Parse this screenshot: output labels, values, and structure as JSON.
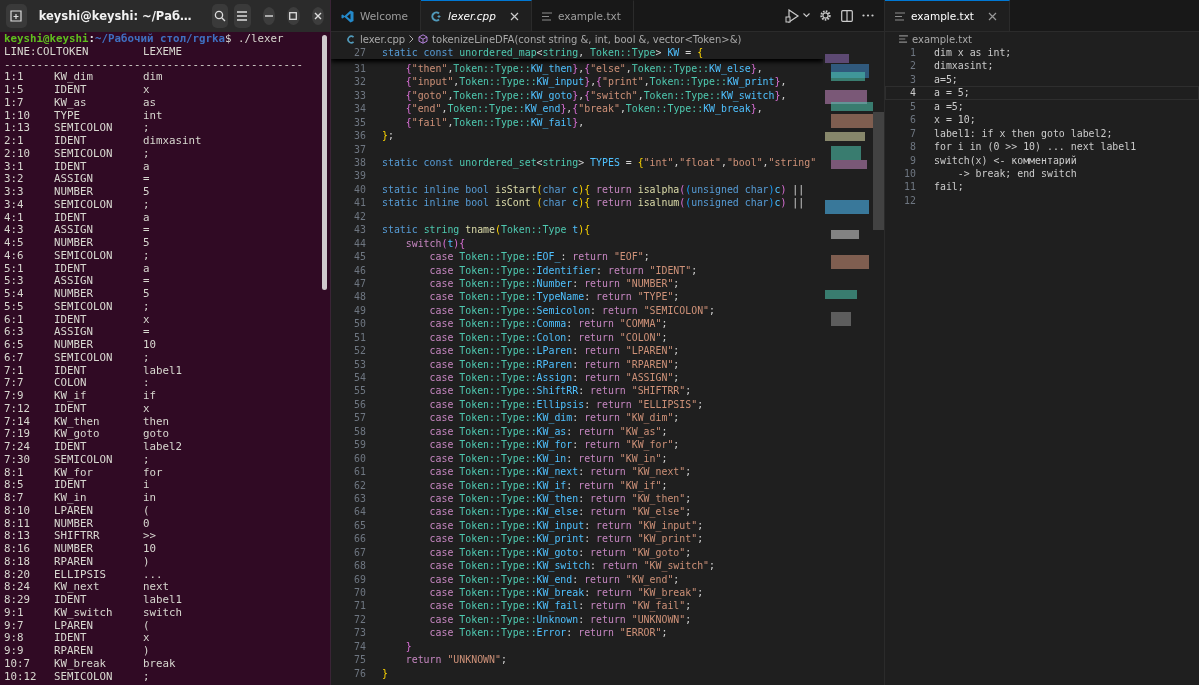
{
  "terminal": {
    "title": "keyshi@keyshi: ~/Раб…",
    "prompt": {
      "user": "keyshi@keyshi",
      "separator": ":",
      "path": "~/Рабочий стол/rgrka",
      "command": "$ ./lexer"
    },
    "header": [
      "LINE:COLTOKEN",
      "LEXEME"
    ],
    "rule": "----------------------------------------------",
    "rows": [
      [
        "1:1",
        "KW_dim",
        "dim"
      ],
      [
        "1:5",
        "IDENT",
        "x"
      ],
      [
        "1:7",
        "KW_as",
        "as"
      ],
      [
        "1:10",
        "TYPE",
        "int"
      ],
      [
        "1:13",
        "SEMICOLON",
        ";"
      ],
      [
        "2:1",
        "IDENT",
        "dimxasint"
      ],
      [
        "2:10",
        "SEMICOLON",
        ";"
      ],
      [
        "3:1",
        "IDENT",
        "a"
      ],
      [
        "3:2",
        "ASSIGN",
        "="
      ],
      [
        "3:3",
        "NUMBER",
        "5"
      ],
      [
        "3:4",
        "SEMICOLON",
        ";"
      ],
      [
        "4:1",
        "IDENT",
        "a"
      ],
      [
        "4:3",
        "ASSIGN",
        "="
      ],
      [
        "4:5",
        "NUMBER",
        "5"
      ],
      [
        "4:6",
        "SEMICOLON",
        ";"
      ],
      [
        "5:1",
        "IDENT",
        "a"
      ],
      [
        "5:3",
        "ASSIGN",
        "="
      ],
      [
        "5:4",
        "NUMBER",
        "5"
      ],
      [
        "5:5",
        "SEMICOLON",
        ";"
      ],
      [
        "6:1",
        "IDENT",
        "x"
      ],
      [
        "6:3",
        "ASSIGN",
        "="
      ],
      [
        "6:5",
        "NUMBER",
        "10"
      ],
      [
        "6:7",
        "SEMICOLON",
        ";"
      ],
      [
        "7:1",
        "IDENT",
        "label1"
      ],
      [
        "7:7",
        "COLON",
        ":"
      ],
      [
        "7:9",
        "KW_if",
        "if"
      ],
      [
        "7:12",
        "IDENT",
        "x"
      ],
      [
        "7:14",
        "KW_then",
        "then"
      ],
      [
        "7:19",
        "KW_goto",
        "goto"
      ],
      [
        "7:24",
        "IDENT",
        "label2"
      ],
      [
        "7:30",
        "SEMICOLON",
        ";"
      ],
      [
        "8:1",
        "KW_for",
        "for"
      ],
      [
        "8:5",
        "IDENT",
        "i"
      ],
      [
        "8:7",
        "KW_in",
        "in"
      ],
      [
        "8:10",
        "LPAREN",
        "("
      ],
      [
        "8:11",
        "NUMBER",
        "0"
      ],
      [
        "8:13",
        "SHIFTRR",
        ">>"
      ],
      [
        "8:16",
        "NUMBER",
        "10"
      ],
      [
        "8:18",
        "RPAREN",
        ")"
      ],
      [
        "8:20",
        "ELLIPSIS",
        "..."
      ],
      [
        "8:24",
        "KW_next",
        "next"
      ],
      [
        "8:29",
        "IDENT",
        "label1"
      ],
      [
        "9:1",
        "KW_switch",
        "switch"
      ],
      [
        "9:7",
        "LPAREN",
        "("
      ],
      [
        "9:8",
        "IDENT",
        "x"
      ],
      [
        "9:9",
        "RPAREN",
        ")"
      ],
      [
        "10:7",
        "KW_break",
        "break"
      ],
      [
        "10:12",
        "SEMICOLON",
        ";"
      ]
    ]
  },
  "editor": {
    "tabs": [
      {
        "label": "Welcome",
        "kind": "welcome",
        "selected": false,
        "preview": false
      },
      {
        "label": "lexer.cpp",
        "kind": "cpp",
        "selected": true,
        "preview": true
      },
      {
        "label": "example.txt",
        "kind": "text",
        "selected": false,
        "preview": false
      }
    ],
    "breadcrumb": {
      "file": "lexer.cpp",
      "symbol": "tokenizeLineDFA(const string &, int, bool &, vector<Token>&)"
    },
    "sticky": {
      "number": "27",
      "tokens": [
        {
          "text": "static const ",
          "kind": "kw"
        },
        {
          "text": "unordered_map",
          "kind": "type"
        },
        {
          "text": "<",
          "kind": "pun"
        },
        {
          "text": "string",
          "kind": "type"
        },
        {
          "text": ", ",
          "kind": "pun"
        },
        {
          "text": "Token::Type",
          "kind": "type"
        },
        {
          "text": "> ",
          "kind": "pun"
        },
        {
          "text": "KW",
          "kind": "mem"
        },
        {
          "text": " = ",
          "kind": "pun"
        },
        {
          "text": "{",
          "kind": "br1"
        }
      ]
    },
    "lines": [
      {
        "number": "31",
        "tokens": [
          {
            "text": "    {",
            "kind": "br2"
          },
          {
            "text": "\"then\"",
            "kind": "str"
          },
          {
            "text": ",",
            "kind": "pun"
          },
          {
            "text": "Token::Type::",
            "kind": "type"
          },
          {
            "text": "KW_then",
            "kind": "mem"
          },
          {
            "text": "}",
            "kind": "br2"
          },
          {
            "text": ",",
            "kind": "pun"
          },
          {
            "text": "{",
            "kind": "br2"
          },
          {
            "text": "\"else\"",
            "kind": "str"
          },
          {
            "text": ",",
            "kind": "pun"
          },
          {
            "text": "Token::Type::",
            "kind": "type"
          },
          {
            "text": "KW_else",
            "kind": "mem"
          },
          {
            "text": "}",
            "kind": "br2"
          },
          {
            "text": ",",
            "kind": "pun"
          }
        ]
      },
      {
        "number": "32",
        "tokens": [
          {
            "text": "    {",
            "kind": "br2"
          },
          {
            "text": "\"input\"",
            "kind": "str"
          },
          {
            "text": ",",
            "kind": "pun"
          },
          {
            "text": "Token::Type::",
            "kind": "type"
          },
          {
            "text": "KW_input",
            "kind": "mem"
          },
          {
            "text": "}",
            "kind": "br2"
          },
          {
            "text": ",",
            "kind": "pun"
          },
          {
            "text": "{",
            "kind": "br2"
          },
          {
            "text": "\"print\"",
            "kind": "str"
          },
          {
            "text": ",",
            "kind": "pun"
          },
          {
            "text": "Token::Type::",
            "kind": "type"
          },
          {
            "text": "KW_print",
            "kind": "mem"
          },
          {
            "text": "}",
            "kind": "br2"
          },
          {
            "text": ",",
            "kind": "pun"
          }
        ]
      },
      {
        "number": "33",
        "tokens": [
          {
            "text": "    {",
            "kind": "br2"
          },
          {
            "text": "\"goto\"",
            "kind": "str"
          },
          {
            "text": ",",
            "kind": "pun"
          },
          {
            "text": "Token::Type::",
            "kind": "type"
          },
          {
            "text": "KW_goto",
            "kind": "mem"
          },
          {
            "text": "}",
            "kind": "br2"
          },
          {
            "text": ",",
            "kind": "pun"
          },
          {
            "text": "{",
            "kind": "br2"
          },
          {
            "text": "\"switch\"",
            "kind": "str"
          },
          {
            "text": ",",
            "kind": "pun"
          },
          {
            "text": "Token::Type::",
            "kind": "type"
          },
          {
            "text": "KW_switch",
            "kind": "mem"
          },
          {
            "text": "}",
            "kind": "br2"
          },
          {
            "text": ",",
            "kind": "pun"
          }
        ]
      },
      {
        "number": "34",
        "tokens": [
          {
            "text": "    {",
            "kind": "br2"
          },
          {
            "text": "\"end\"",
            "kind": "str"
          },
          {
            "text": ",",
            "kind": "pun"
          },
          {
            "text": "Token::Type::",
            "kind": "type"
          },
          {
            "text": "KW_end",
            "kind": "mem"
          },
          {
            "text": "}",
            "kind": "br2"
          },
          {
            "text": ",",
            "kind": "pun"
          },
          {
            "text": "{",
            "kind": "br2"
          },
          {
            "text": "\"break\"",
            "kind": "str"
          },
          {
            "text": ",",
            "kind": "pun"
          },
          {
            "text": "Token::Type::",
            "kind": "type"
          },
          {
            "text": "KW_break",
            "kind": "mem"
          },
          {
            "text": "}",
            "kind": "br2"
          },
          {
            "text": ",",
            "kind": "pun"
          }
        ]
      },
      {
        "number": "35",
        "tokens": [
          {
            "text": "    {",
            "kind": "br2"
          },
          {
            "text": "\"fail\"",
            "kind": "str"
          },
          {
            "text": ",",
            "kind": "pun"
          },
          {
            "text": "Token::Type::",
            "kind": "type"
          },
          {
            "text": "KW_fail",
            "kind": "mem"
          },
          {
            "text": "}",
            "kind": "br2"
          },
          {
            "text": ",",
            "kind": "pun"
          }
        ]
      },
      {
        "number": "36",
        "tokens": [
          {
            "text": "}",
            "kind": "br1"
          },
          {
            "text": ";",
            "kind": "pun"
          }
        ]
      },
      {
        "number": "37"
      },
      {
        "number": "38",
        "tokens": [
          {
            "text": "static const ",
            "kind": "kw"
          },
          {
            "text": "unordered_set",
            "kind": "type"
          },
          {
            "text": "<",
            "kind": "pun"
          },
          {
            "text": "string",
            "kind": "type"
          },
          {
            "text": "> ",
            "kind": "pun"
          },
          {
            "text": "TYPES",
            "kind": "mem"
          },
          {
            "text": " = ",
            "kind": "pun"
          },
          {
            "text": "{",
            "kind": "br1"
          },
          {
            "text": "\"int\"",
            "kind": "str"
          },
          {
            "text": ",",
            "kind": "pun"
          },
          {
            "text": "\"float\"",
            "kind": "str"
          },
          {
            "text": ",",
            "kind": "pun"
          },
          {
            "text": "\"bool\"",
            "kind": "str"
          },
          {
            "text": ",",
            "kind": "pun"
          },
          {
            "text": "\"string\"",
            "kind": "str"
          }
        ]
      },
      {
        "number": "39"
      },
      {
        "number": "40",
        "tokens": [
          {
            "text": "static inline bool ",
            "kind": "kw"
          },
          {
            "text": "isStart",
            "kind": "fn"
          },
          {
            "text": "(",
            "kind": "br1"
          },
          {
            "text": "char ",
            "kind": "kw"
          },
          {
            "text": "c",
            "kind": "mem"
          },
          {
            "text": ")",
            "kind": "br1"
          },
          {
            "text": "{",
            "kind": "br1"
          },
          {
            "text": " return ",
            "kind": "ctl"
          },
          {
            "text": "isalpha",
            "kind": "fn"
          },
          {
            "text": "(",
            "kind": "br2"
          },
          {
            "text": "(",
            "kind": "br3"
          },
          {
            "text": "unsigned char",
            "kind": "kw"
          },
          {
            "text": ")",
            "kind": "br3"
          },
          {
            "text": "c",
            "kind": "mem"
          },
          {
            "text": ")",
            "kind": "br2"
          },
          {
            "text": " ||",
            "kind": "pun"
          }
        ]
      },
      {
        "number": "41",
        "tokens": [
          {
            "text": "static inline bool ",
            "kind": "kw"
          },
          {
            "text": "isCont ",
            "kind": "fn"
          },
          {
            "text": "(",
            "kind": "br1"
          },
          {
            "text": "char ",
            "kind": "kw"
          },
          {
            "text": "c",
            "kind": "mem"
          },
          {
            "text": ")",
            "kind": "br1"
          },
          {
            "text": "{",
            "kind": "br1"
          },
          {
            "text": " return ",
            "kind": "ctl"
          },
          {
            "text": "isalnum",
            "kind": "fn"
          },
          {
            "text": "(",
            "kind": "br2"
          },
          {
            "text": "(",
            "kind": "br3"
          },
          {
            "text": "unsigned char",
            "kind": "kw"
          },
          {
            "text": ")",
            "kind": "br3"
          },
          {
            "text": "c",
            "kind": "mem"
          },
          {
            "text": ")",
            "kind": "br2"
          },
          {
            "text": " ||",
            "kind": "pun"
          }
        ]
      },
      {
        "number": "42"
      },
      {
        "number": "43",
        "tokens": [
          {
            "text": "static ",
            "kind": "kw"
          },
          {
            "text": "string ",
            "kind": "type"
          },
          {
            "text": "tname",
            "kind": "fn"
          },
          {
            "text": "(",
            "kind": "br1"
          },
          {
            "text": "Token::Type ",
            "kind": "type"
          },
          {
            "text": "t",
            "kind": "mem"
          },
          {
            "text": ")",
            "kind": "br1"
          },
          {
            "text": "{",
            "kind": "br1"
          }
        ]
      },
      {
        "number": "44",
        "tokens": [
          {
            "text": "    switch",
            "kind": "ctl"
          },
          {
            "text": "(",
            "kind": "br2"
          },
          {
            "text": "t",
            "kind": "mem"
          },
          {
            "text": ")",
            "kind": "br2"
          },
          {
            "text": "{",
            "kind": "br2"
          }
        ]
      },
      {
        "number": "45",
        "tokens": [
          {
            "text": "        case ",
            "kind": "ctl"
          },
          {
            "text": "Token::Type::",
            "kind": "type"
          },
          {
            "text": "EOF_",
            "kind": "mem"
          },
          {
            "text": ": ",
            "kind": "pun"
          },
          {
            "text": "return ",
            "kind": "ctl"
          },
          {
            "text": "\"EOF\"",
            "kind": "str"
          },
          {
            "text": ";",
            "kind": "pun"
          }
        ]
      },
      {
        "number": "46",
        "tokens": [
          {
            "text": "        case ",
            "kind": "ctl"
          },
          {
            "text": "Token::Type::",
            "kind": "type"
          },
          {
            "text": "Identifier",
            "kind": "mem"
          },
          {
            "text": ": ",
            "kind": "pun"
          },
          {
            "text": "return ",
            "kind": "ctl"
          },
          {
            "text": "\"IDENT\"",
            "kind": "str"
          },
          {
            "text": ";",
            "kind": "pun"
          }
        ]
      },
      {
        "number": "47",
        "tokens": [
          {
            "text": "        case ",
            "kind": "ctl"
          },
          {
            "text": "Token::Type::",
            "kind": "type"
          },
          {
            "text": "Number",
            "kind": "mem"
          },
          {
            "text": ": ",
            "kind": "pun"
          },
          {
            "text": "return ",
            "kind": "ctl"
          },
          {
            "text": "\"NUMBER\"",
            "kind": "str"
          },
          {
            "text": ";",
            "kind": "pun"
          }
        ]
      },
      {
        "number": "48",
        "tokens": [
          {
            "text": "        case ",
            "kind": "ctl"
          },
          {
            "text": "Token::Type::",
            "kind": "type"
          },
          {
            "text": "TypeName",
            "kind": "mem"
          },
          {
            "text": ": ",
            "kind": "pun"
          },
          {
            "text": "return ",
            "kind": "ctl"
          },
          {
            "text": "\"TYPE\"",
            "kind": "str"
          },
          {
            "text": ";",
            "kind": "pun"
          }
        ]
      },
      {
        "number": "49",
        "tokens": [
          {
            "text": "        case ",
            "kind": "ctl"
          },
          {
            "text": "Token::Type::",
            "kind": "type"
          },
          {
            "text": "Semicolon",
            "kind": "mem"
          },
          {
            "text": ": ",
            "kind": "pun"
          },
          {
            "text": "return ",
            "kind": "ctl"
          },
          {
            "text": "\"SEMICOLON\"",
            "kind": "str"
          },
          {
            "text": ";",
            "kind": "pun"
          }
        ]
      },
      {
        "number": "50",
        "tokens": [
          {
            "text": "        case ",
            "kind": "ctl"
          },
          {
            "text": "Token::Type::",
            "kind": "type"
          },
          {
            "text": "Comma",
            "kind": "mem"
          },
          {
            "text": ": ",
            "kind": "pun"
          },
          {
            "text": "return ",
            "kind": "ctl"
          },
          {
            "text": "\"COMMA\"",
            "kind": "str"
          },
          {
            "text": ";",
            "kind": "pun"
          }
        ]
      },
      {
        "number": "51",
        "tokens": [
          {
            "text": "        case ",
            "kind": "ctl"
          },
          {
            "text": "Token::Type::",
            "kind": "type"
          },
          {
            "text": "Colon",
            "kind": "mem"
          },
          {
            "text": ": ",
            "kind": "pun"
          },
          {
            "text": "return ",
            "kind": "ctl"
          },
          {
            "text": "\"COLON\"",
            "kind": "str"
          },
          {
            "text": ";",
            "kind": "pun"
          }
        ]
      },
      {
        "number": "52",
        "tokens": [
          {
            "text": "        case ",
            "kind": "ctl"
          },
          {
            "text": "Token::Type::",
            "kind": "type"
          },
          {
            "text": "LParen",
            "kind": "mem"
          },
          {
            "text": ": ",
            "kind": "pun"
          },
          {
            "text": "return ",
            "kind": "ctl"
          },
          {
            "text": "\"LPAREN\"",
            "kind": "str"
          },
          {
            "text": ";",
            "kind": "pun"
          }
        ]
      },
      {
        "number": "53",
        "tokens": [
          {
            "text": "        case ",
            "kind": "ctl"
          },
          {
            "text": "Token::Type::",
            "kind": "type"
          },
          {
            "text": "RParen",
            "kind": "mem"
          },
          {
            "text": ": ",
            "kind": "pun"
          },
          {
            "text": "return ",
            "kind": "ctl"
          },
          {
            "text": "\"RPAREN\"",
            "kind": "str"
          },
          {
            "text": ";",
            "kind": "pun"
          }
        ]
      },
      {
        "number": "54",
        "tokens": [
          {
            "text": "        case ",
            "kind": "ctl"
          },
          {
            "text": "Token::Type::",
            "kind": "type"
          },
          {
            "text": "Assign",
            "kind": "mem"
          },
          {
            "text": ": ",
            "kind": "pun"
          },
          {
            "text": "return ",
            "kind": "ctl"
          },
          {
            "text": "\"ASSIGN\"",
            "kind": "str"
          },
          {
            "text": ";",
            "kind": "pun"
          }
        ]
      },
      {
        "number": "55",
        "tokens": [
          {
            "text": "        case ",
            "kind": "ctl"
          },
          {
            "text": "Token::Type::",
            "kind": "type"
          },
          {
            "text": "ShiftRR",
            "kind": "mem"
          },
          {
            "text": ": ",
            "kind": "pun"
          },
          {
            "text": "return ",
            "kind": "ctl"
          },
          {
            "text": "\"SHIFTRR\"",
            "kind": "str"
          },
          {
            "text": ";",
            "kind": "pun"
          }
        ]
      },
      {
        "number": "56",
        "tokens": [
          {
            "text": "        case ",
            "kind": "ctl"
          },
          {
            "text": "Token::Type::",
            "kind": "type"
          },
          {
            "text": "Ellipsis",
            "kind": "mem"
          },
          {
            "text": ": ",
            "kind": "pun"
          },
          {
            "text": "return ",
            "kind": "ctl"
          },
          {
            "text": "\"ELLIPSIS\"",
            "kind": "str"
          },
          {
            "text": ";",
            "kind": "pun"
          }
        ]
      },
      {
        "number": "57",
        "tokens": [
          {
            "text": "        case ",
            "kind": "ctl"
          },
          {
            "text": "Token::Type::",
            "kind": "type"
          },
          {
            "text": "KW_dim",
            "kind": "mem"
          },
          {
            "text": ": ",
            "kind": "pun"
          },
          {
            "text": "return ",
            "kind": "ctl"
          },
          {
            "text": "\"KW_dim\"",
            "kind": "str"
          },
          {
            "text": ";",
            "kind": "pun"
          }
        ]
      },
      {
        "number": "58",
        "tokens": [
          {
            "text": "        case ",
            "kind": "ctl"
          },
          {
            "text": "Token::Type::",
            "kind": "type"
          },
          {
            "text": "KW_as",
            "kind": "mem"
          },
          {
            "text": ": ",
            "kind": "pun"
          },
          {
            "text": "return ",
            "kind": "ctl"
          },
          {
            "text": "\"KW_as\"",
            "kind": "str"
          },
          {
            "text": ";",
            "kind": "pun"
          }
        ]
      },
      {
        "number": "59",
        "tokens": [
          {
            "text": "        case ",
            "kind": "ctl"
          },
          {
            "text": "Token::Type::",
            "kind": "type"
          },
          {
            "text": "KW_for",
            "kind": "mem"
          },
          {
            "text": ": ",
            "kind": "pun"
          },
          {
            "text": "return ",
            "kind": "ctl"
          },
          {
            "text": "\"KW_for\"",
            "kind": "str"
          },
          {
            "text": ";",
            "kind": "pun"
          }
        ]
      },
      {
        "number": "60",
        "tokens": [
          {
            "text": "        case ",
            "kind": "ctl"
          },
          {
            "text": "Token::Type::",
            "kind": "type"
          },
          {
            "text": "KW_in",
            "kind": "mem"
          },
          {
            "text": ": ",
            "kind": "pun"
          },
          {
            "text": "return ",
            "kind": "ctl"
          },
          {
            "text": "\"KW_in\"",
            "kind": "str"
          },
          {
            "text": ";",
            "kind": "pun"
          }
        ]
      },
      {
        "number": "61",
        "tokens": [
          {
            "text": "        case ",
            "kind": "ctl"
          },
          {
            "text": "Token::Type::",
            "kind": "type"
          },
          {
            "text": "KW_next",
            "kind": "mem"
          },
          {
            "text": ": ",
            "kind": "pun"
          },
          {
            "text": "return ",
            "kind": "ctl"
          },
          {
            "text": "\"KW_next\"",
            "kind": "str"
          },
          {
            "text": ";",
            "kind": "pun"
          }
        ]
      },
      {
        "number": "62",
        "tokens": [
          {
            "text": "        case ",
            "kind": "ctl"
          },
          {
            "text": "Token::Type::",
            "kind": "type"
          },
          {
            "text": "KW_if",
            "kind": "mem"
          },
          {
            "text": ": ",
            "kind": "pun"
          },
          {
            "text": "return ",
            "kind": "ctl"
          },
          {
            "text": "\"KW_if\"",
            "kind": "str"
          },
          {
            "text": ";",
            "kind": "pun"
          }
        ]
      },
      {
        "number": "63",
        "tokens": [
          {
            "text": "        case ",
            "kind": "ctl"
          },
          {
            "text": "Token::Type::",
            "kind": "type"
          },
          {
            "text": "KW_then",
            "kind": "mem"
          },
          {
            "text": ": ",
            "kind": "pun"
          },
          {
            "text": "return ",
            "kind": "ctl"
          },
          {
            "text": "\"KW_then\"",
            "kind": "str"
          },
          {
            "text": ";",
            "kind": "pun"
          }
        ]
      },
      {
        "number": "64",
        "tokens": [
          {
            "text": "        case ",
            "kind": "ctl"
          },
          {
            "text": "Token::Type::",
            "kind": "type"
          },
          {
            "text": "KW_else",
            "kind": "mem"
          },
          {
            "text": ": ",
            "kind": "pun"
          },
          {
            "text": "return ",
            "kind": "ctl"
          },
          {
            "text": "\"KW_else\"",
            "kind": "str"
          },
          {
            "text": ";",
            "kind": "pun"
          }
        ]
      },
      {
        "number": "65",
        "tokens": [
          {
            "text": "        case ",
            "kind": "ctl"
          },
          {
            "text": "Token::Type::",
            "kind": "type"
          },
          {
            "text": "KW_input",
            "kind": "mem"
          },
          {
            "text": ": ",
            "kind": "pun"
          },
          {
            "text": "return ",
            "kind": "ctl"
          },
          {
            "text": "\"KW_input\"",
            "kind": "str"
          },
          {
            "text": ";",
            "kind": "pun"
          }
        ]
      },
      {
        "number": "66",
        "tokens": [
          {
            "text": "        case ",
            "kind": "ctl"
          },
          {
            "text": "Token::Type::",
            "kind": "type"
          },
          {
            "text": "KW_print",
            "kind": "mem"
          },
          {
            "text": ": ",
            "kind": "pun"
          },
          {
            "text": "return ",
            "kind": "ctl"
          },
          {
            "text": "\"KW_print\"",
            "kind": "str"
          },
          {
            "text": ";",
            "kind": "pun"
          }
        ]
      },
      {
        "number": "67",
        "tokens": [
          {
            "text": "        case ",
            "kind": "ctl"
          },
          {
            "text": "Token::Type::",
            "kind": "type"
          },
          {
            "text": "KW_goto",
            "kind": "mem"
          },
          {
            "text": ": ",
            "kind": "pun"
          },
          {
            "text": "return ",
            "kind": "ctl"
          },
          {
            "text": "\"KW_goto\"",
            "kind": "str"
          },
          {
            "text": ";",
            "kind": "pun"
          }
        ]
      },
      {
        "number": "68",
        "tokens": [
          {
            "text": "        case ",
            "kind": "ctl"
          },
          {
            "text": "Token::Type::",
            "kind": "type"
          },
          {
            "text": "KW_switch",
            "kind": "mem"
          },
          {
            "text": ": ",
            "kind": "pun"
          },
          {
            "text": "return ",
            "kind": "ctl"
          },
          {
            "text": "\"KW_switch\"",
            "kind": "str"
          },
          {
            "text": ";",
            "kind": "pun"
          }
        ]
      },
      {
        "number": "69",
        "tokens": [
          {
            "text": "        case ",
            "kind": "ctl"
          },
          {
            "text": "Token::Type::",
            "kind": "type"
          },
          {
            "text": "KW_end",
            "kind": "mem"
          },
          {
            "text": ": ",
            "kind": "pun"
          },
          {
            "text": "return ",
            "kind": "ctl"
          },
          {
            "text": "\"KW_end\"",
            "kind": "str"
          },
          {
            "text": ";",
            "kind": "pun"
          }
        ]
      },
      {
        "number": "70",
        "tokens": [
          {
            "text": "        case ",
            "kind": "ctl"
          },
          {
            "text": "Token::Type::",
            "kind": "type"
          },
          {
            "text": "KW_break",
            "kind": "mem"
          },
          {
            "text": ": ",
            "kind": "pun"
          },
          {
            "text": "return ",
            "kind": "ctl"
          },
          {
            "text": "\"KW_break\"",
            "kind": "str"
          },
          {
            "text": ";",
            "kind": "pun"
          }
        ]
      },
      {
        "number": "71",
        "tokens": [
          {
            "text": "        case ",
            "kind": "ctl"
          },
          {
            "text": "Token::Type::",
            "kind": "type"
          },
          {
            "text": "KW_fail",
            "kind": "mem"
          },
          {
            "text": ": ",
            "kind": "pun"
          },
          {
            "text": "return ",
            "kind": "ctl"
          },
          {
            "text": "\"KW_fail\"",
            "kind": "str"
          },
          {
            "text": ";",
            "kind": "pun"
          }
        ]
      },
      {
        "number": "72",
        "tokens": [
          {
            "text": "        case ",
            "kind": "ctl"
          },
          {
            "text": "Token::Type::",
            "kind": "type"
          },
          {
            "text": "Unknown",
            "kind": "mem"
          },
          {
            "text": ": ",
            "kind": "pun"
          },
          {
            "text": "return ",
            "kind": "ctl"
          },
          {
            "text": "\"UNKNOWN\"",
            "kind": "str"
          },
          {
            "text": ";",
            "kind": "pun"
          }
        ]
      },
      {
        "number": "73",
        "tokens": [
          {
            "text": "        case ",
            "kind": "ctl"
          },
          {
            "text": "Token::Type::",
            "kind": "type"
          },
          {
            "text": "Error",
            "kind": "mem"
          },
          {
            "text": ": ",
            "kind": "pun"
          },
          {
            "text": "return ",
            "kind": "ctl"
          },
          {
            "text": "\"ERROR\"",
            "kind": "str"
          },
          {
            "text": ";",
            "kind": "pun"
          }
        ]
      },
      {
        "number": "74",
        "tokens": [
          {
            "text": "    }",
            "kind": "br2"
          }
        ]
      },
      {
        "number": "75",
        "tokens": [
          {
            "text": "    return ",
            "kind": "ctl"
          },
          {
            "text": "\"UNKNOWN\"",
            "kind": "str"
          },
          {
            "text": ";",
            "kind": "pun"
          }
        ]
      },
      {
        "number": "76",
        "tokens": [
          {
            "text": "}",
            "kind": "br1"
          }
        ]
      }
    ]
  },
  "side_editor": {
    "tabs": [
      {
        "label": "example.txt",
        "kind": "text",
        "selected": true,
        "preview": false
      }
    ],
    "breadcrumb": "example.txt",
    "lines": [
      {
        "number": "1",
        "text": "dim x as int;",
        "current": false
      },
      {
        "number": "2",
        "text": "dimxasint;",
        "current": false
      },
      {
        "number": "3",
        "text": "a=5;",
        "current": false
      },
      {
        "number": "4",
        "text": "a = 5;",
        "current": true
      },
      {
        "number": "5",
        "text": "a =5;",
        "current": false
      },
      {
        "number": "6",
        "text": "x = 10;",
        "current": false
      },
      {
        "number": "7",
        "text": "label1: if x then goto label2;",
        "current": false
      },
      {
        "number": "8",
        "text": "for i in (0 >> 10) ... next label1",
        "current": false
      },
      {
        "number": "9",
        "text": "switch(x) <- комментарий",
        "current": false
      },
      {
        "number": "10",
        "text": "    -> break; end switch",
        "current": false
      },
      {
        "number": "11",
        "text": "fail;",
        "current": false
      },
      {
        "number": "12",
        "current": false
      }
    ]
  }
}
